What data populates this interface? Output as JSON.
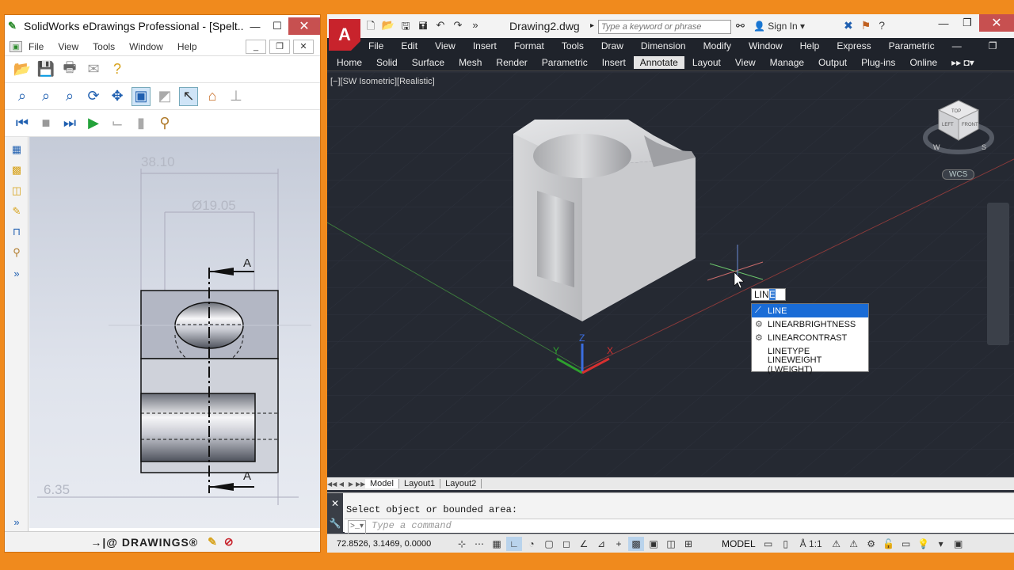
{
  "edrawings": {
    "title": "SolidWorks eDrawings Professional - [Spelt....",
    "menu": [
      "File",
      "View",
      "Tools",
      "Window",
      "Help"
    ],
    "dims": {
      "width_top": "38.10",
      "diameter": "Ø19.05",
      "section_top": "A",
      "section_bottom": "A",
      "bottom_dim": "6.35"
    },
    "brand": "→|@ DRAWINGS®"
  },
  "autocad": {
    "doc_title": "Drawing2.dwg",
    "search_placeholder": "Type a keyword or phrase",
    "sign_in": "Sign In",
    "menu": [
      "File",
      "Edit",
      "View",
      "Insert",
      "Format",
      "Tools",
      "Draw",
      "Dimension",
      "Modify",
      "Window",
      "Help",
      "Express",
      "Parametric"
    ],
    "ribbon_tabs": [
      "Home",
      "Solid",
      "Surface",
      "Mesh",
      "Render",
      "Parametric",
      "Insert",
      "Annotate",
      "Layout",
      "View",
      "Manage",
      "Output",
      "Plug-ins",
      "Online"
    ],
    "active_tab": "Annotate",
    "viewport_label": "[−][SW Isometric][Realistic]",
    "wcs": "WCS",
    "viewcube": {
      "top": "TOP",
      "left": "LEFT",
      "front": "FRONT",
      "compass_w": "W",
      "compass_s": "S"
    },
    "axes": {
      "x": "X",
      "y": "Y",
      "z": "Z"
    },
    "typed": {
      "prefix": "LIN",
      "highlight": "E"
    },
    "suggestions": [
      "LINE",
      "LINEARBRIGHTNESS",
      "LINEARCONTRAST",
      "LINETYPE",
      "LINEWEIGHT (LWEIGHT)"
    ],
    "layout_tabs": [
      "Model",
      "Layout1",
      "Layout2"
    ],
    "command_history": "Select object or bounded area:",
    "command_placeholder": "Type a command",
    "coords": "72.8526, 3.1469, 0.0000",
    "model_label": "MODEL",
    "scale": "1:1"
  },
  "colors": {
    "desktop": "#f08a1d",
    "autocad_bg": "#252932",
    "highlight": "#1a6cd6",
    "close_red": "#c75050"
  }
}
